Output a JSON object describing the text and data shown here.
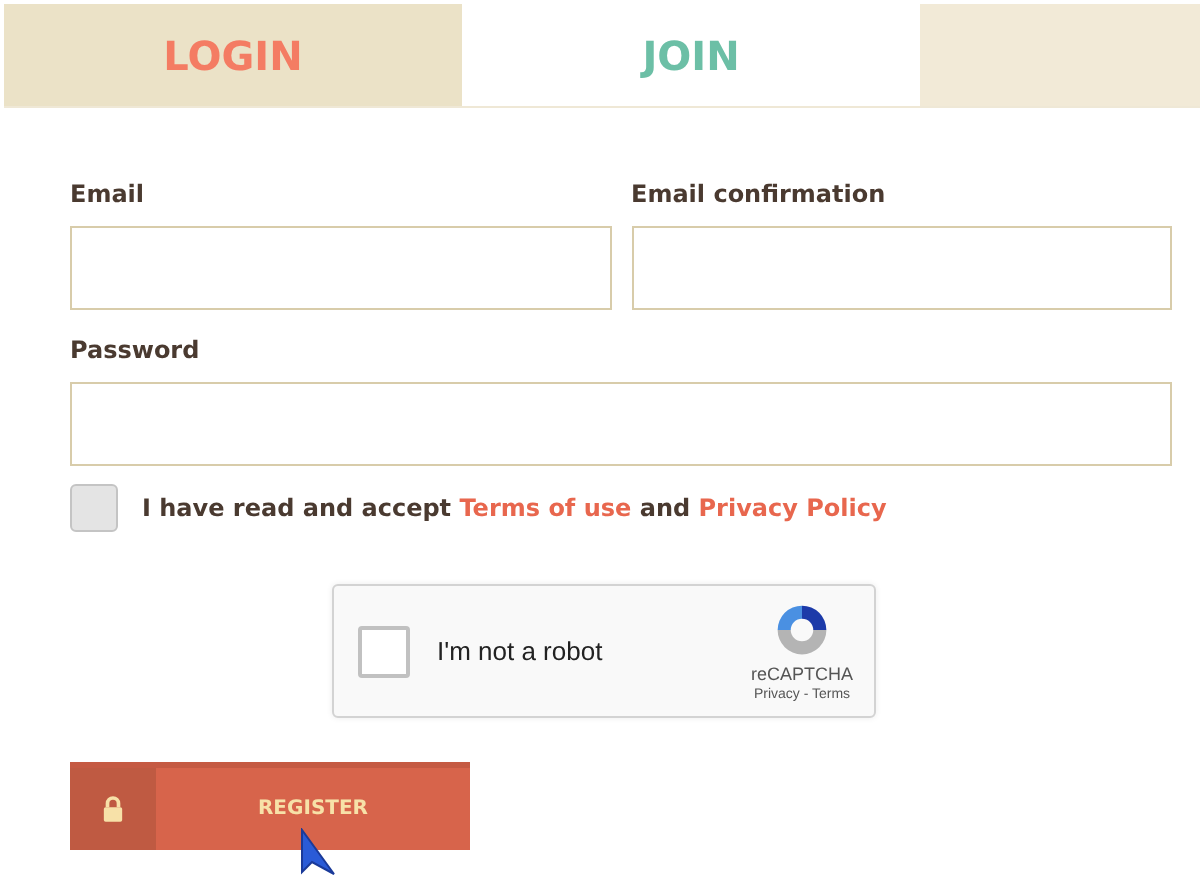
{
  "tabs": [
    {
      "label": "LOGIN",
      "selected": false
    },
    {
      "label": "JOIN",
      "selected": true
    }
  ],
  "fields": [
    {
      "label": "Email"
    },
    {
      "label": "Email confirmation"
    },
    {
      "label": "Password"
    }
  ],
  "agreement": {
    "checked": false,
    "parts": [
      {
        "kind": "text",
        "text": "I have read and accept "
      },
      {
        "kind": "link",
        "text": "Terms of use"
      },
      {
        "kind": "text",
        "text": " and "
      },
      {
        "kind": "link",
        "text": "Privacy Policy"
      }
    ]
  },
  "captcha": {
    "checked": false,
    "label": "I'm not a robot",
    "brand": "reCAPTCHA",
    "links": "Privacy - Terms"
  },
  "register_button": {
    "label": "REGISTER"
  }
}
